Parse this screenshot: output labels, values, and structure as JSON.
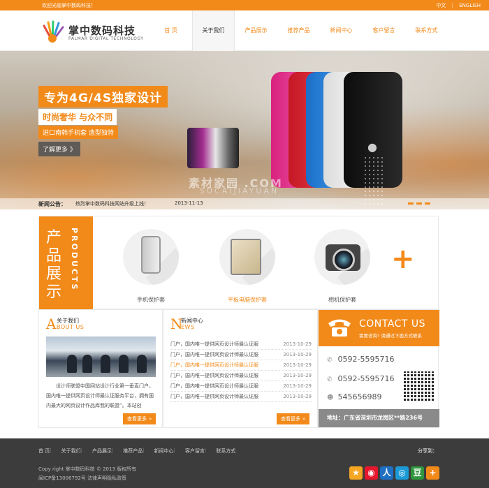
{
  "colors": {
    "accent": "#f28a1a",
    "footer": "#3c3c3c",
    "address_bar": "#8a8a8a"
  },
  "topbar": {
    "welcome": "欢迎光临掌中数码科技！",
    "lang_cn": "中文",
    "lang_sep": "|",
    "lang_en": "ENGLISH"
  },
  "brand": {
    "name_cn": "掌中数码科技",
    "name_en": "PALMAR DIGITAL TECHNOLOGY"
  },
  "nav": [
    {
      "label": "首 页"
    },
    {
      "label": "关于我们"
    },
    {
      "label": "产品展示"
    },
    {
      "label": "推荐产品"
    },
    {
      "label": "新闻中心"
    },
    {
      "label": "客户留言"
    },
    {
      "label": "联系方式"
    }
  ],
  "banner": {
    "title": "专为4G/4S独家设计",
    "sub1": "时尚奢华 与众不同",
    "sub2": "进口南韩手机套 造型独特",
    "more": "了解更多 》",
    "watermark1": "素材家园 .COM",
    "watermark2": "SUCAIJIAYUAN"
  },
  "notice": {
    "label": "新闻公告：",
    "text": "热烈掌中数码科技网站升级上线！",
    "date": "2013-11-13"
  },
  "products": {
    "label_cn": "产品展示",
    "label_en": "PRODUCTS",
    "items": [
      {
        "name": "手机保护套",
        "icon": "phone-icon"
      },
      {
        "name": "平板电脑保护套",
        "icon": "tablet-icon"
      },
      {
        "name": "相机保护套",
        "icon": "camera-icon"
      }
    ],
    "plus": "+"
  },
  "about": {
    "letter": "A",
    "title_cn": "关于我们",
    "title_en": "BOUT US",
    "text": "设计师联盟中国网站设计行业第一垂直门户，国内唯一提供网页设计师最认证服务平台，拥有国内最大的网页设计作品库我的联盟”。本站创",
    "more": "查看更多",
    "more_arrow": "»"
  },
  "news": {
    "letter": "N",
    "title_cn": "新闻中心",
    "title_en": "EWS",
    "items": [
      {
        "title": "门户，国内唯一提供网页设计师最认证服",
        "date": "2013-10-29"
      },
      {
        "title": "门户，国内唯一提供网页设计师最认证服",
        "date": "2013-10-29"
      },
      {
        "title": "门户，国内唯一提供网页设计师最认证服",
        "date": "2013-10-29"
      },
      {
        "title": "门户，国内唯一提供网页设计师最认证服",
        "date": "2013-10-29"
      },
      {
        "title": "门户，国内唯一提供网页设计师最认证服",
        "date": "2013-10-29"
      },
      {
        "title": "门户，国内唯一提供网页设计师最认证服",
        "date": "2013-10-29"
      }
    ],
    "more": "查看更多",
    "more_arrow": "»"
  },
  "contact": {
    "title": "CONTACT US",
    "subtitle": "需要咨询? 请通过下面方式联系",
    "phone1": "0592-5595716",
    "phone2": "0592-5595716",
    "qq": "545656989",
    "address": "地址：广东省深圳市龙岗区**路236号"
  },
  "footer": {
    "nav": [
      "首 页",
      "关于我们",
      "产品展示",
      "推荐产品",
      "新闻中心",
      "客户留言",
      "联系方式"
    ],
    "sep": "|",
    "share_label": "分享到：",
    "copyright": "Copy right 掌中数码科技 © 2013 版权所有",
    "icp": "闽ICP备13006792号 法律声明隐私政策",
    "share_icons": [
      {
        "name": "qzone-icon",
        "glyph": "★",
        "color": "#f5a623"
      },
      {
        "name": "weibo-icon",
        "glyph": "◉",
        "color": "#e6162d"
      },
      {
        "name": "renren-icon",
        "glyph": "人",
        "color": "#1f6fc2"
      },
      {
        "name": "tencent-weibo-icon",
        "glyph": "◎",
        "color": "#1b9ad6"
      },
      {
        "name": "douban-icon",
        "glyph": "豆",
        "color": "#2e963d"
      },
      {
        "name": "more-share-icon",
        "glyph": "+",
        "color": "#f28a1a"
      }
    ]
  }
}
